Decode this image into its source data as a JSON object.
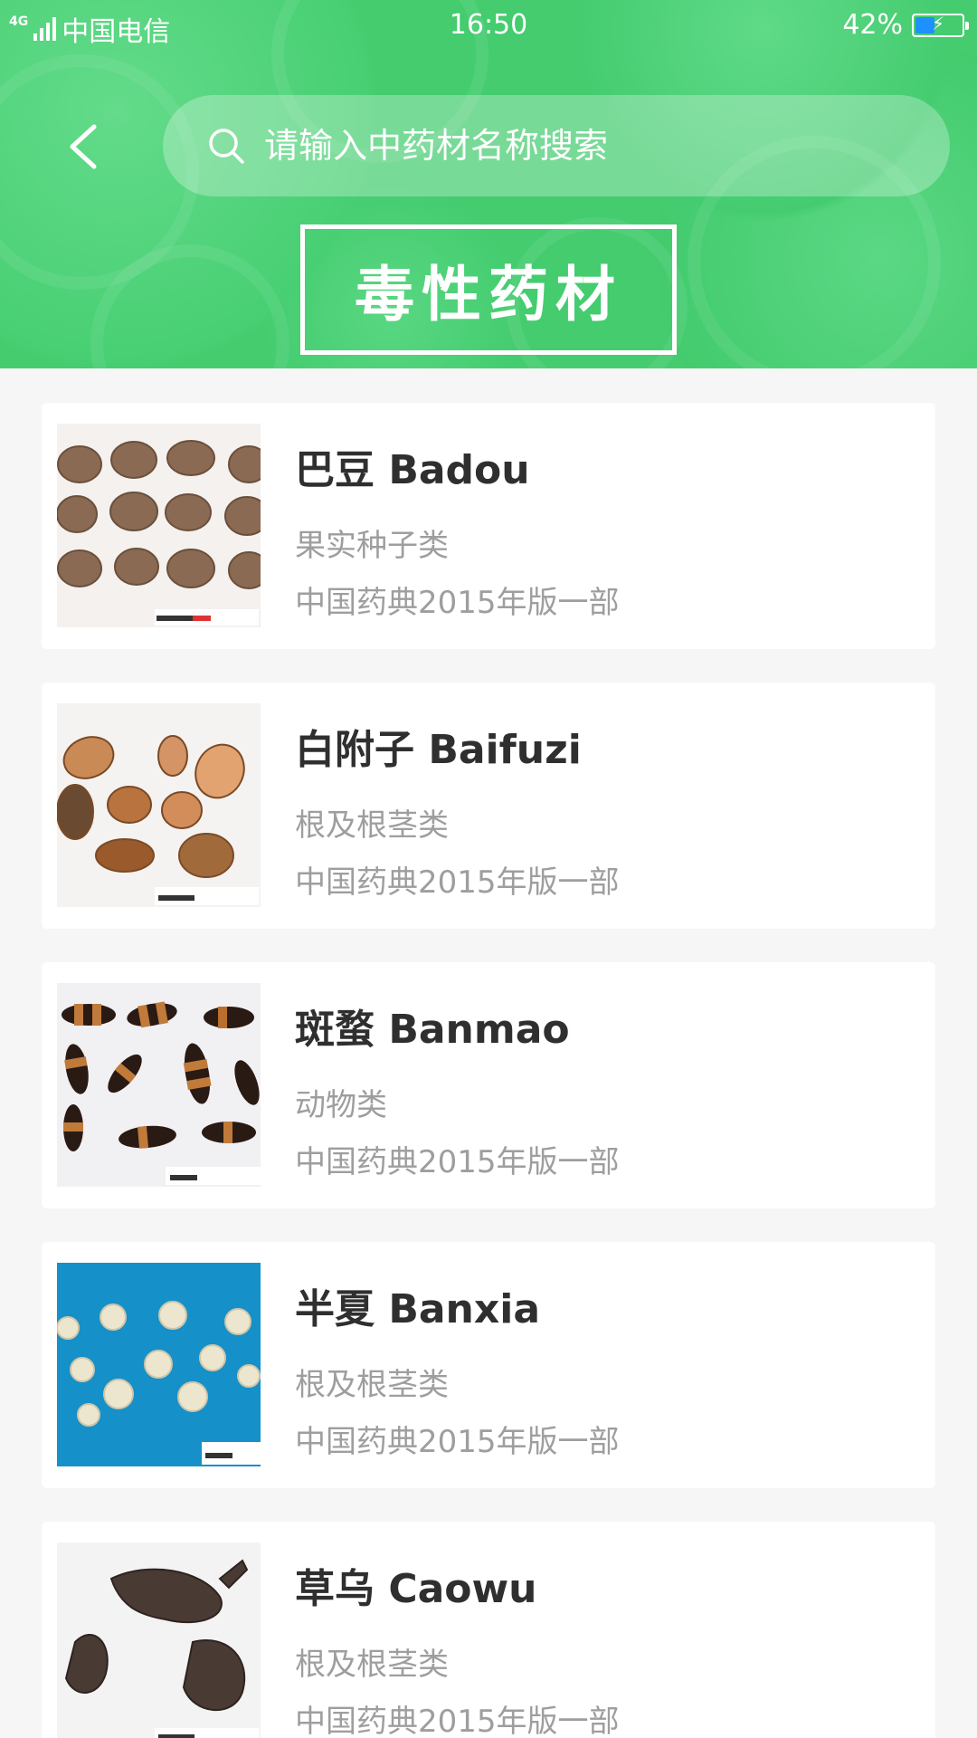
{
  "status_bar": {
    "network": "4G",
    "carrier": "中国电信",
    "time": "16:50",
    "battery": "42%",
    "battery_level": 0.42
  },
  "header": {
    "search_placeholder": "请输入中药材名称搜索",
    "title": "毒性药材"
  },
  "items": [
    {
      "name": "巴豆  Badou",
      "category": "果实种子类",
      "source": "中国药典2015年版一部"
    },
    {
      "name": "白附子  Baifuzi",
      "category": "根及根茎类",
      "source": "中国药典2015年版一部"
    },
    {
      "name": "斑蝥  Banmao",
      "category": "动物类",
      "source": "中国药典2015年版一部"
    },
    {
      "name": "半夏  Banxia",
      "category": "根及根茎类",
      "source": "中国药典2015年版一部"
    },
    {
      "name": "草乌  Caowu",
      "category": "根及根茎类",
      "source": "中国药典2015年版一部"
    }
  ],
  "colors": {
    "header_green": "#44cc6f",
    "title_text": "#2f2f2f",
    "secondary_text": "#9e9e9e",
    "battery_fill": "#1e90ff"
  }
}
